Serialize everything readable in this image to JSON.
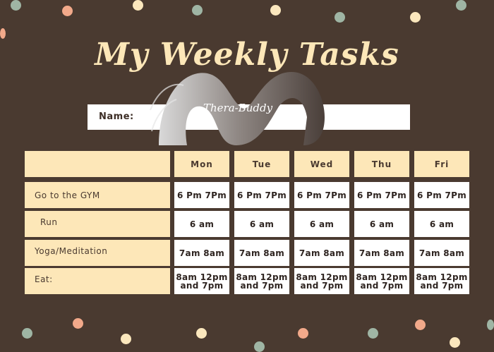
{
  "title": "My Weekly Tasks",
  "name_label": "Name:",
  "logo_text": "Thera-Buddy",
  "days": [
    "Mon",
    "Tue",
    "Wed",
    "Thu",
    "Fri"
  ],
  "rows": [
    {
      "label": "Go to the GYM",
      "values": [
        "6 Pm 7Pm",
        "6 Pm 7Pm",
        "6 Pm 7Pm",
        "6 Pm 7Pm",
        "6 Pm 7Pm"
      ]
    },
    {
      "label": "Run",
      "values": [
        "6 am",
        "6 am",
        "6 am",
        "6 am",
        "6 am"
      ]
    },
    {
      "label": "Yoga/Meditation",
      "values": [
        "7am 8am",
        "7am 8am",
        "7am 8am",
        "7am 8am",
        "7am 8am"
      ]
    },
    {
      "label": "Eat:",
      "values": [
        "8am 12pm and 7pm",
        "8am 12pm and 7pm",
        "8am 12pm and 7pm",
        "8am 12pm and 7pm",
        "8am 12pm and 7pm"
      ]
    }
  ],
  "colors": {
    "background": "#4a3a30",
    "cream": "#fde7b8",
    "peach_dot": "#f2a98a",
    "sage_dot": "#9fb5a4"
  }
}
